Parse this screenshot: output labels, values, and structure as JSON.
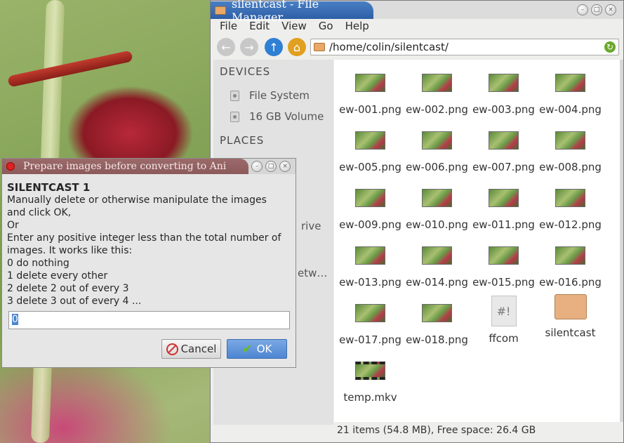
{
  "file_manager": {
    "title": "silentcast - File Manager",
    "menu": [
      "File",
      "Edit",
      "View",
      "Go",
      "Help"
    ],
    "address": "/home/colin/silentcast/",
    "sidebar": {
      "devices_heading": "DEVICES",
      "devices": [
        "File System",
        "16 GB Volume"
      ],
      "places_heading": "PLACES",
      "obscured_items": [
        "rive",
        "etw…"
      ]
    },
    "files": [
      {
        "name": "ew-001.png",
        "type": "image"
      },
      {
        "name": "ew-002.png",
        "type": "image"
      },
      {
        "name": "ew-003.png",
        "type": "image"
      },
      {
        "name": "ew-004.png",
        "type": "image"
      },
      {
        "name": "ew-005.png",
        "type": "image"
      },
      {
        "name": "ew-006.png",
        "type": "image"
      },
      {
        "name": "ew-007.png",
        "type": "image"
      },
      {
        "name": "ew-008.png",
        "type": "image"
      },
      {
        "name": "ew-009.png",
        "type": "image"
      },
      {
        "name": "ew-010.png",
        "type": "image"
      },
      {
        "name": "ew-011.png",
        "type": "image"
      },
      {
        "name": "ew-012.png",
        "type": "image"
      },
      {
        "name": "ew-013.png",
        "type": "image"
      },
      {
        "name": "ew-014.png",
        "type": "image"
      },
      {
        "name": "ew-015.png",
        "type": "image"
      },
      {
        "name": "ew-016.png",
        "type": "image"
      },
      {
        "name": "ew-017.png",
        "type": "image"
      },
      {
        "name": "ew-018.png",
        "type": "image"
      },
      {
        "name": "ffcom",
        "type": "script",
        "icon_text": "#!"
      },
      {
        "name": "silentcast",
        "type": "folder"
      },
      {
        "name": "temp.mkv",
        "type": "video"
      }
    ],
    "status": "21 items (54.8 MB), Free space: 26.4 GB"
  },
  "dialog": {
    "title": "Prepare images before converting to Ani",
    "heading": "SILENTCAST 1",
    "lines": [
      "Manually delete or otherwise manipulate the images",
      "and click OK,",
      "Or",
      "Enter any positive integer less than the total number of",
      "images. It works like this:",
      "0 do nothing",
      "1 delete every other",
      "2 delete 2 out of every 3",
      "3 delete 3 out of every 4 ..."
    ],
    "input_value": "0",
    "cancel_label": "Cancel",
    "ok_label": "OK"
  }
}
